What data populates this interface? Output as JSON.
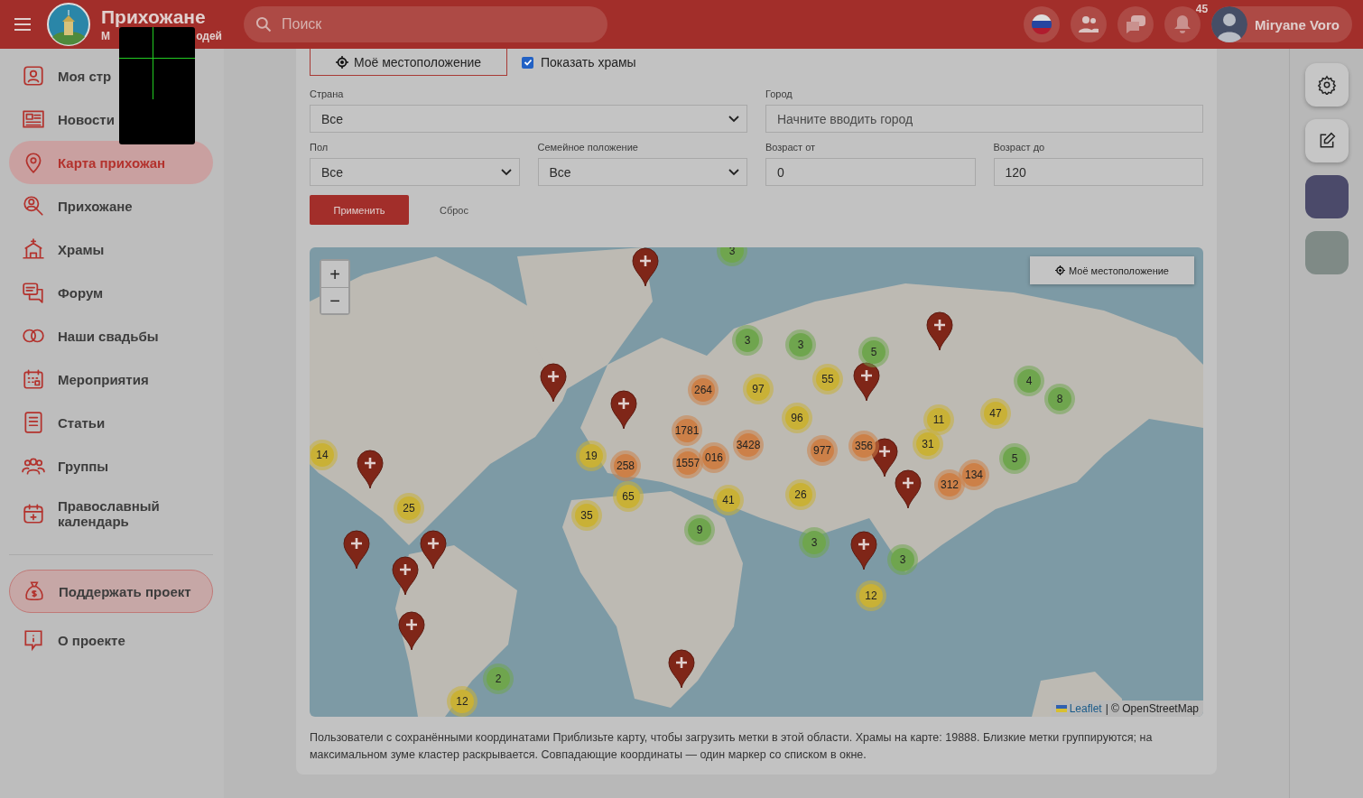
{
  "header": {
    "title": "Прихожане",
    "subtitle_parts": [
      "М",
      "одей"
    ],
    "search": {
      "placeholder": "Поиск"
    },
    "notification_count": "45",
    "user": {
      "name": "Miryane Voro"
    }
  },
  "sidebar": {
    "items": [
      {
        "label": "Моя стр",
        "selected": false
      },
      {
        "label": "Новости",
        "selected": false
      },
      {
        "label": "Карта прихожан",
        "selected": true
      },
      {
        "label": "Прихожане",
        "selected": false
      },
      {
        "label": "Храмы",
        "selected": false
      },
      {
        "label": "Форум",
        "selected": false
      },
      {
        "label": "Наши свадьбы",
        "selected": false
      },
      {
        "label": "Мероприятия",
        "selected": false
      },
      {
        "label": "Статьи",
        "selected": false
      },
      {
        "label": "Группы",
        "selected": false
      },
      {
        "label": "Православный календарь",
        "selected": false
      }
    ],
    "support_button": "Поддержать проект",
    "about": "О проекте"
  },
  "filters": {
    "location_button": "Моё местоположение",
    "show_temples": {
      "label": "Показать храмы",
      "checked": true
    },
    "fields": [
      {
        "label": "Страна",
        "kind": "select",
        "value": "Все"
      },
      {
        "label": "Город",
        "kind": "input",
        "placeholder": "Начните вводить город"
      },
      {
        "label": "Пол",
        "kind": "select",
        "value": "Все"
      },
      {
        "label": "Семейное положение",
        "kind": "select",
        "value": "Все"
      },
      {
        "label": "Возраст от",
        "kind": "input",
        "value": "0"
      },
      {
        "label": "Возраст до",
        "kind": "input",
        "value": "120"
      }
    ],
    "apply": "Применить",
    "reset": "Сброс"
  },
  "map": {
    "zoom_in": "+",
    "zoom_out": "−",
    "location_button": "Моё местоположение",
    "attribution_link": "Leaflet",
    "attribution_text": "| © OpenStreetMap",
    "clusters": [
      {
        "count": "3",
        "color": "#6fa54e"
      },
      {
        "count": "3",
        "color": "#6fa54e"
      },
      {
        "count": "3",
        "color": "#6fa54e"
      },
      {
        "count": "5",
        "color": "#6fa54e"
      },
      {
        "count": "264",
        "color": "#cc8048"
      },
      {
        "count": "97",
        "color": "#c9b136"
      },
      {
        "count": "55",
        "color": "#c9b136"
      },
      {
        "count": "4",
        "color": "#6fa54e"
      },
      {
        "count": "8",
        "color": "#6fa54e"
      },
      {
        "count": "96",
        "color": "#c9b136"
      },
      {
        "count": "11",
        "color": "#c9b136"
      },
      {
        "count": "47",
        "color": "#c9b136"
      },
      {
        "count": "1781",
        "color": "#cc8048"
      },
      {
        "count": "14",
        "color": "#c9b136"
      },
      {
        "count": "19",
        "color": "#c9b136"
      },
      {
        "count": "258",
        "color": "#cc8048"
      },
      {
        "count": "1557",
        "color": "#cc8048"
      },
      {
        "count": "016",
        "color": "#cc8048"
      },
      {
        "count": "3428",
        "color": "#cc8048"
      },
      {
        "count": "977",
        "color": "#cc8048"
      },
      {
        "count": "356",
        "color": "#cc8048"
      },
      {
        "count": "31",
        "color": "#c9b136"
      },
      {
        "count": "5",
        "color": "#6fa54e"
      },
      {
        "count": "312",
        "color": "#cc8048"
      },
      {
        "count": "134",
        "color": "#cc8048"
      },
      {
        "count": "25",
        "color": "#c9b136"
      },
      {
        "count": "35",
        "color": "#c9b136"
      },
      {
        "count": "65",
        "color": "#c9b136"
      },
      {
        "count": "41",
        "color": "#c9b136"
      },
      {
        "count": "26",
        "color": "#c9b136"
      },
      {
        "count": "9",
        "color": "#6fa54e"
      },
      {
        "count": "3",
        "color": "#6fa54e"
      },
      {
        "count": "3",
        "color": "#6fa54e"
      },
      {
        "count": "12",
        "color": "#c9b136"
      },
      {
        "count": "2",
        "color": "#6fa54e"
      },
      {
        "count": "12",
        "color": "#c9b136"
      }
    ]
  },
  "note": "Пользователи с сохранёнными координатами Приблизьте карту, чтобы загрузить метки в этой области. Храмы на карте: 19888. Близкие метки группируются; на максимальном зуме кластер раскрывается. Совпадающие координаты — один маркер со списком в окне."
}
